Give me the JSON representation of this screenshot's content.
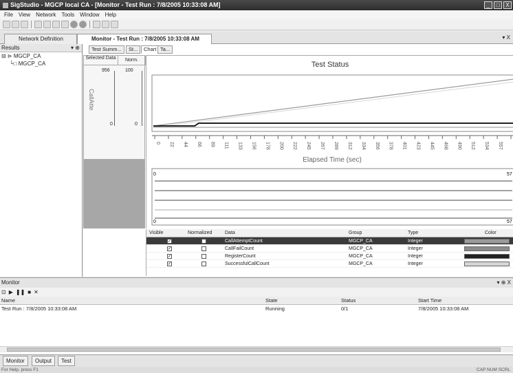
{
  "window": {
    "title": "SigStudio - MGCP local CA - [Monitor - Test Run : 7/8/2005 10:33:08 AM]",
    "buttons": [
      "_",
      "□",
      "X"
    ]
  },
  "menu": [
    "File",
    "View",
    "Network",
    "Tools",
    "Window",
    "Help"
  ],
  "doc_tabs": {
    "network": "Network Definition",
    "monitor": "Monitor - Test Run : 7/8/2005 10:33:08 AM"
  },
  "results": {
    "header": "Results",
    "pin": "▾ ⊕",
    "root": "MGCP_CA",
    "child": "MGCP_CA"
  },
  "subtabs": [
    "Test Summ...",
    "St...",
    "Chart",
    "Ta..."
  ],
  "selected_panel": {
    "selected_data": "Selected Data",
    "norm": "Norm.",
    "axis_label": "CallAtte",
    "raw_max": "956",
    "raw_min": "0",
    "norm_max": "100",
    "norm_min": "0"
  },
  "chart_data": {
    "type": "line",
    "title": "Test Status",
    "xlabel": "Elapsed Time (sec)",
    "ylabel": "CallAtte",
    "x_ticks": [
      "0",
      "22",
      "44",
      "66",
      "89",
      "111",
      "133",
      "156",
      "178",
      "200",
      "222",
      "245",
      "267",
      "289",
      "312",
      "334",
      "356",
      "378",
      "401",
      "423",
      "445",
      "468",
      "490",
      "512",
      "534",
      "557",
      "57"
    ],
    "overview_start": "0",
    "overview_end": "57",
    "overview_start_bottom": "0",
    "overview_end_bottom": "57",
    "ylim": [
      0,
      956
    ],
    "grid": false,
    "legend": "table-below"
  },
  "data_table": {
    "headers": {
      "visible": "Visible",
      "normalized": "Normalized",
      "data": "Data",
      "group": "Group",
      "type": "Type",
      "color": "Color"
    },
    "rows": [
      {
        "data": "CallAttemptCount",
        "group": "MGCP_CA",
        "type": "Integer",
        "visible": true,
        "normalized": true,
        "color": "#9a9a9a"
      },
      {
        "data": "CallFailCount",
        "group": "MGCP_CA",
        "type": "Integer",
        "visible": true,
        "normalized": false,
        "color": "#8c8c8c"
      },
      {
        "data": "RegisterCount",
        "group": "MGCP_CA",
        "type": "Integer",
        "visible": true,
        "normalized": false,
        "color": "#222222"
      },
      {
        "data": "SuccessfulCallCount",
        "group": "MGCP_CA",
        "type": "Integer",
        "visible": true,
        "normalized": false,
        "color": "#d6d6d6"
      }
    ]
  },
  "monitor": {
    "header": "Monitor",
    "pin": "▾ ⊕ X",
    "columns": {
      "name": "Name",
      "state": "State",
      "status": "Status",
      "start": "Start Time"
    },
    "row": {
      "name": "Test Run : 7/8/2005 10:33:08 AM",
      "state": "Running",
      "status": "0/1",
      "start": "7/8/2005 10:33:08 AM"
    }
  },
  "bottom_tabs": [
    "Monitor",
    "Output",
    "Test"
  ],
  "statusbar": {
    "left": "For Help, press F1",
    "right": "CAP NUM SCRL"
  },
  "colors": {
    "title_bg": "#2d2d2d",
    "selected_row": "#3a3a3a",
    "panel_gray": "#a7a7a7"
  }
}
